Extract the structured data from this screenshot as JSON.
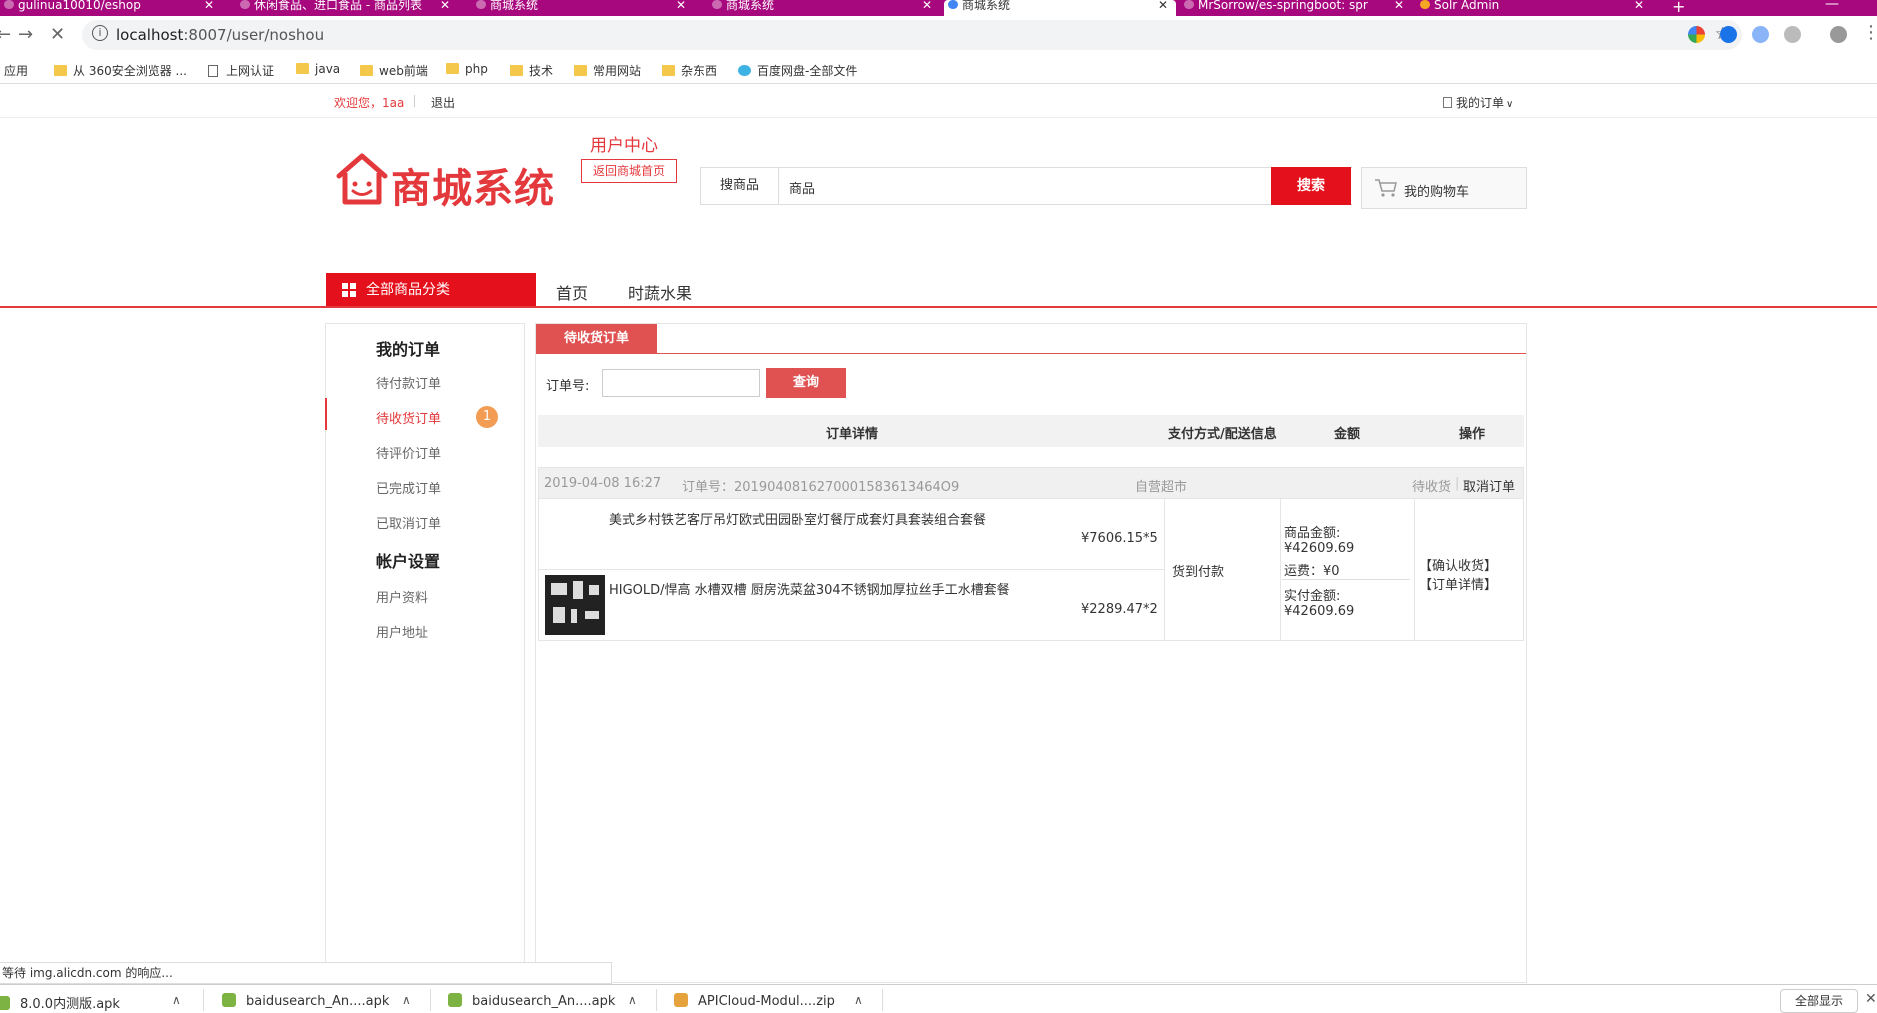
{
  "browser": {
    "tabs": [
      {
        "title": "gulinua10010/eshop"
      },
      {
        "title": "休闲食品、进口食品 - 商品列表"
      },
      {
        "title": "商城系统"
      },
      {
        "title": "商城系统"
      },
      {
        "title": "商城系统"
      },
      {
        "title": "MrSorrow/es-springboot: spr"
      },
      {
        "title": "Solr Admin"
      }
    ],
    "url_host": "localhost",
    "url_path": ":8007/user/noshou",
    "bookmarks": [
      {
        "label": "应用"
      },
      {
        "label": "从 360安全浏览器 ..."
      },
      {
        "label": "上网认证"
      },
      {
        "label": "java"
      },
      {
        "label": "web前端"
      },
      {
        "label": "php"
      },
      {
        "label": "技术"
      },
      {
        "label": "常用网站"
      },
      {
        "label": "杂东西"
      },
      {
        "label": "百度网盘-全部文件"
      }
    ]
  },
  "site": {
    "welcome": "欢迎您，1aa",
    "logout": "退出",
    "my_orders": "我的订单",
    "logo_text": "商城系统",
    "user_center": "用户中心",
    "back_home": "返回商城首页",
    "search_type": "搜商品",
    "search_value": "商品",
    "search_button": "搜索",
    "cart_label": "我的购物车",
    "all_categories": "全部商品分类",
    "nav": [
      {
        "label": "首页"
      },
      {
        "label": "时蔬水果"
      }
    ]
  },
  "sidebar": {
    "orders_heading": "我的订单",
    "items": [
      {
        "label": "待付款订单"
      },
      {
        "label": "待收货订单"
      },
      {
        "label": "待评价订单"
      },
      {
        "label": "已完成订单"
      },
      {
        "label": "已取消订单"
      }
    ],
    "badge": "1",
    "account_heading": "帐户设置",
    "account_items": [
      {
        "label": "用户资料"
      },
      {
        "label": "用户地址"
      }
    ]
  },
  "main": {
    "tab": "待收货订单",
    "query_label": "订单号:",
    "query_button": "查询",
    "columns": {
      "detail": "订单详情",
      "pay": "支付方式/配送信息",
      "amount": "金额",
      "action": "操作"
    },
    "order": {
      "date": "2019-04-08 16:27",
      "order_no": "订单号：2019040816270001583613464О9",
      "store": "自营超市",
      "status": "待收货",
      "cancel": "取消订单",
      "items": [
        {
          "name": "美式乡村铁艺客厅吊灯欧式田园卧室灯餐厅成套灯具套装组合套餐",
          "price": "¥7606.15*5"
        },
        {
          "name": "HIGOLD/悍高 水槽双槽 厨房洗菜盆304不锈钢加厚拉丝手工水槽套餐",
          "price": "¥2289.47*2"
        }
      ],
      "pay_method": "货到付款",
      "goods_amount_label": "商品金额:",
      "goods_amount": "¥42609.69",
      "shipping": "运费：¥0",
      "paid_label": "实付金额:",
      "paid_amount": "¥42609.69",
      "confirm": "【确认收货】",
      "detail_link": "【订单详情】"
    }
  },
  "status_text": "等待 img.alicdn.com 的响应...",
  "downloads": [
    {
      "name": "8.0.0内测版.apk"
    },
    {
      "name": "baidusearch_An....apk"
    },
    {
      "name": "baidusearch_An....apk"
    },
    {
      "name": "APICloud-Modul....zip"
    }
  ],
  "show_all": "全部显示",
  "colors": {
    "brand": "#e4393c",
    "tabbar": "#a8087e"
  }
}
